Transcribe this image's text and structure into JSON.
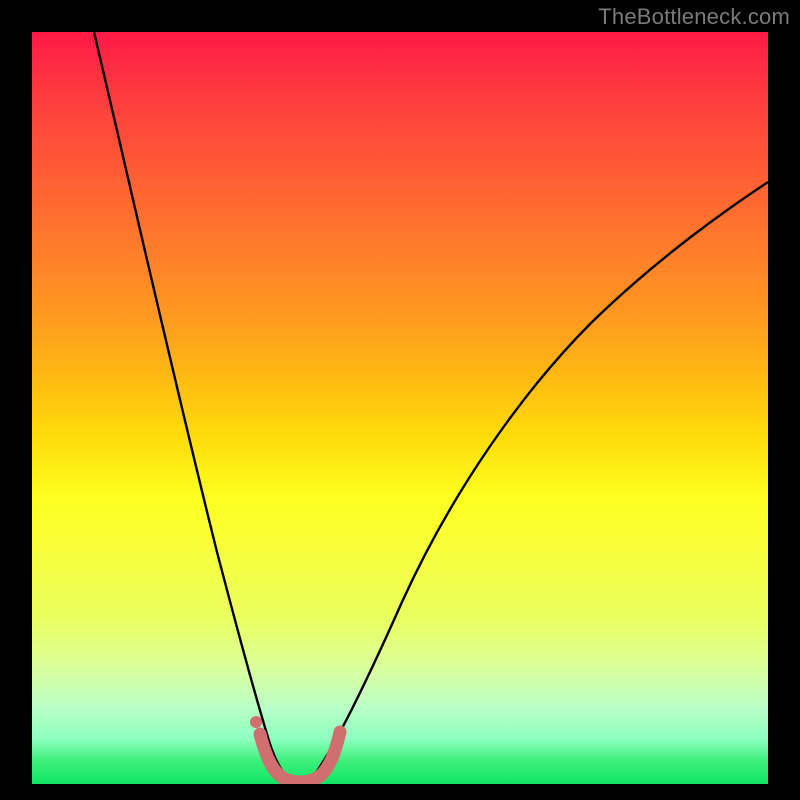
{
  "watermark": "TheBottleneck.com",
  "chart_data": {
    "type": "line",
    "title": "",
    "xlabel": "",
    "ylabel": "",
    "xlim": [
      0,
      100
    ],
    "ylim": [
      0,
      100
    ],
    "series": [
      {
        "name": "bottleneck-curve",
        "x": [
          8,
          12,
          16,
          20,
          24,
          26,
          28,
          30,
          31,
          32,
          33,
          34,
          35,
          36,
          38,
          42,
          48,
          56,
          66,
          78,
          90,
          100
        ],
        "y": [
          100,
          85,
          70,
          54,
          36,
          26,
          16,
          6,
          2,
          0,
          0,
          0,
          0,
          2,
          8,
          20,
          34,
          48,
          60,
          70,
          77,
          82
        ]
      }
    ],
    "annotations": [
      {
        "name": "optimal-range-marker",
        "x_start": 30,
        "x_end": 36,
        "color": "#d06a6a"
      }
    ]
  }
}
